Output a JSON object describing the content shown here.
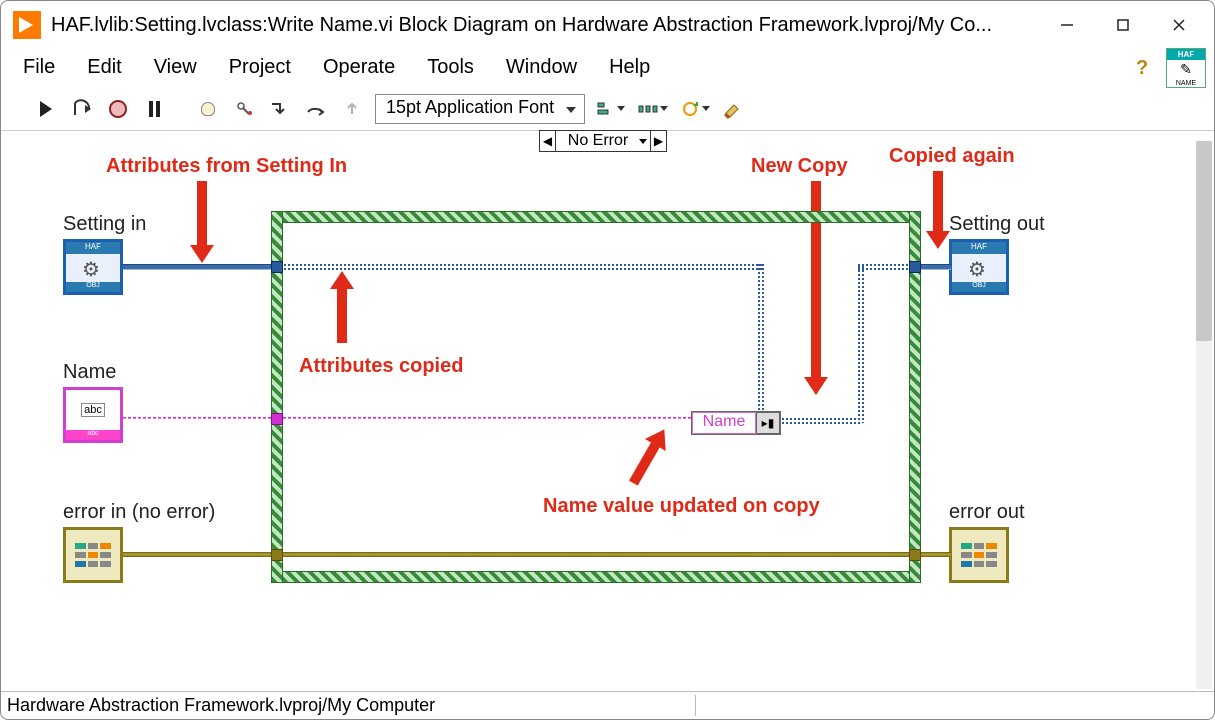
{
  "window": {
    "title": "HAF.lvlib:Setting.lvclass:Write Name.vi Block Diagram on Hardware Abstraction Framework.lvproj/My Co..."
  },
  "menu": {
    "file": "File",
    "edit": "Edit",
    "view": "View",
    "project": "Project",
    "operate": "Operate",
    "tools": "Tools",
    "window": "Window",
    "help": "Help"
  },
  "toolbar": {
    "font": "15pt Application Font"
  },
  "vi_palette": {
    "top": "HAF",
    "bottom": "NAME"
  },
  "structure": {
    "selector": "No Error"
  },
  "terminals": {
    "setting_in": "Setting in",
    "setting_out": "Setting out",
    "name": "Name",
    "error_in": "error in (no error)",
    "error_out": "error out",
    "obj_badge": "OBJ",
    "haf_badge": "HAF",
    "abc": "abc"
  },
  "propnode": {
    "name": "Name"
  },
  "annotations": {
    "attrs_from": "Attributes from Setting In",
    "attrs_copied": "Attributes copied",
    "new_copy": "New Copy",
    "copied_again": "Copied again",
    "name_updated": "Name value updated on copy"
  },
  "statusbar": {
    "path": "Hardware Abstraction Framework.lvproj/My Computer"
  }
}
